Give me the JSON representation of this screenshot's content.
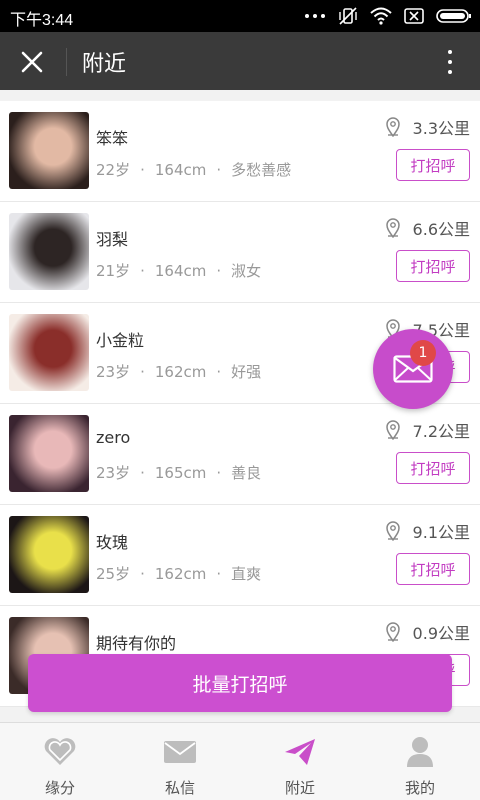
{
  "status_bar": {
    "time": "下午3:44"
  },
  "title_bar": {
    "title": "附近"
  },
  "colors": {
    "accent": "#c94ec9",
    "titlebar": "#3a3a3a",
    "badge": "#e04848"
  },
  "list": [
    {
      "name": "笨笨",
      "age": "22岁",
      "height": "164cm",
      "trait": "多愁善感",
      "distance": "3.3公里",
      "greet_label": "打招呼",
      "avatar_colors": [
        "#2b1f1c",
        "#e2b9a4"
      ]
    },
    {
      "name": "羽梨",
      "age": "21岁",
      "height": "164cm",
      "trait": "淑女",
      "distance": "6.6公里",
      "greet_label": "打招呼",
      "avatar_colors": [
        "#e6e6ea",
        "#2d2524"
      ]
    },
    {
      "name": "小金粒",
      "age": "23岁",
      "height": "162cm",
      "trait": "好强",
      "distance": "7.5公里",
      "greet_label": "打招呼",
      "avatar_colors": [
        "#f5ece6",
        "#8a2e2a"
      ]
    },
    {
      "name": "zero",
      "age": "23岁",
      "height": "165cm",
      "trait": "善良",
      "distance": "7.2公里",
      "greet_label": "打招呼",
      "avatar_colors": [
        "#3a2430",
        "#e8b8b8"
      ]
    },
    {
      "name": "玫瑰",
      "age": "25岁",
      "height": "162cm",
      "trait": "直爽",
      "distance": "9.1公里",
      "greet_label": "打招呼",
      "avatar_colors": [
        "#1c1616",
        "#e9e04a"
      ]
    },
    {
      "name": "期待有你的",
      "age": "",
      "height": "",
      "trait": "",
      "distance": "0.9公里",
      "greet_label": "打招呼",
      "avatar_colors": [
        "#3b2b28",
        "#e6c1b3"
      ]
    }
  ],
  "fab": {
    "badge": "1",
    "icon": "mail-icon"
  },
  "batch_button": {
    "label": "批量打招呼"
  },
  "bottom_nav": [
    {
      "label": "缘分",
      "icon": "heart-icon"
    },
    {
      "label": "私信",
      "icon": "mail-icon"
    },
    {
      "label": "附近",
      "icon": "paper-plane-icon"
    },
    {
      "label": "我的",
      "icon": "person-icon"
    }
  ]
}
